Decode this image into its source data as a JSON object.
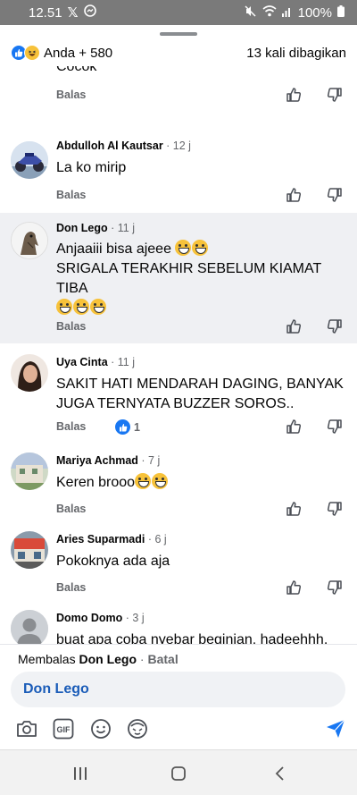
{
  "status_bar": {
    "time": "12.51",
    "battery": "100%"
  },
  "header": {
    "reaction_summary": "Anda + 580",
    "share_count": "13 kali dibagikan"
  },
  "comments": [
    {
      "author": "",
      "time": "",
      "text": "Cocok",
      "reply_label": "Balas",
      "likes": ""
    },
    {
      "author": "Abdulloh Al Kautsar",
      "time": " · 12 j",
      "text": "La ko mirip",
      "reply_label": "Balas",
      "likes": ""
    },
    {
      "author": "Don Lego",
      "time": " · 11 j",
      "text_line1": "Anjaaiii bisa ajeee",
      "text_line2": "SRIGALA TERAKHIR SEBELUM KIAMAT",
      "text_line3": "TIBA",
      "reply_label": "Balas",
      "likes": ""
    },
    {
      "author": "Uya Cinta",
      "time": " · 11 j",
      "text": "SAKIT HATI MENDARAH DAGING, BANYAK JUGA TERNYATA BUZZER SOROS..",
      "reply_label": "Balas",
      "likes": "1"
    },
    {
      "author": "Mariya Achmad",
      "time": " · 7 j",
      "text": "Keren brooo",
      "reply_label": "Balas",
      "likes": ""
    },
    {
      "author": "Aries Suparmadi",
      "time": " · 6 j",
      "text": "Pokoknya ada aja",
      "reply_label": "Balas",
      "likes": ""
    },
    {
      "author": "Domo Domo",
      "time": " · 3 j",
      "text": "buat apa coba nyebar beginian, hadeehhh. mending fokus membangun negeri ini sama",
      "reply_label": "",
      "likes": ""
    }
  ],
  "reply_bar": {
    "prefix": "Membalas ",
    "target": "Don Lego",
    "separator": " · ",
    "cancel": "Batal",
    "input_value": "Don Lego"
  },
  "colors": {
    "accent": "#1877f2",
    "highlight": "#eff0f3",
    "muted": "#65676b"
  },
  "icons": [
    "like-reaction-icon",
    "haha-reaction-icon",
    "thumbs-up-icon",
    "thumbs-down-icon",
    "camera-icon",
    "gif-icon",
    "emoji-icon",
    "avatar-sticker-icon",
    "send-icon"
  ]
}
